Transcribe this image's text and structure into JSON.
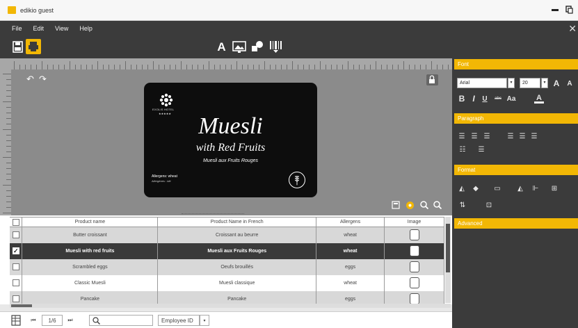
{
  "window": {
    "title": "edikio guest"
  },
  "menu": {
    "items": [
      "File",
      "Edit",
      "View",
      "Help"
    ]
  },
  "label": {
    "brand": "EXOLIS HOTEL",
    "stars": "★★★★★",
    "title": "Muesli",
    "subtitle": "with Red Fruits",
    "french": "Muesli aux Fruits Rouges",
    "allergens": "Allergens: wheat",
    "allergens_fr": "Allergènes : blé"
  },
  "right_panel": {
    "font_header": "Font",
    "font_name": "Arial",
    "font_size": "20",
    "paragraph_header": "Paragraph",
    "format_header": "Format",
    "advanced_header": "Advanced",
    "case_label": "Aa",
    "strike_label": "abc"
  },
  "table": {
    "headers": [
      "Product name",
      "Product Name in French",
      "Allergens",
      "Image"
    ],
    "rows": [
      {
        "name": "Butter croissant",
        "french": "Croissant au beurre",
        "allergens": "wheat",
        "checked": false
      },
      {
        "name": "Muesli with red fruits",
        "french": "Muesli aux Fruits Rouges",
        "allergens": "wheat",
        "checked": true
      },
      {
        "name": "Scrambled eggs",
        "french": "Oeufs brouillés",
        "allergens": "eggs",
        "checked": false
      },
      {
        "name": "Classic Muesli",
        "french": "Muesli classique",
        "allergens": "wheat",
        "checked": false
      },
      {
        "name": "Pancake",
        "french": "Pancake",
        "allergens": "eggs",
        "checked": false
      }
    ]
  },
  "pager": {
    "page": "1/6",
    "search_placeholder": "",
    "field": "Employee ID"
  },
  "colors": {
    "accent": "#f2b705",
    "dark": "#3b3b3b"
  }
}
